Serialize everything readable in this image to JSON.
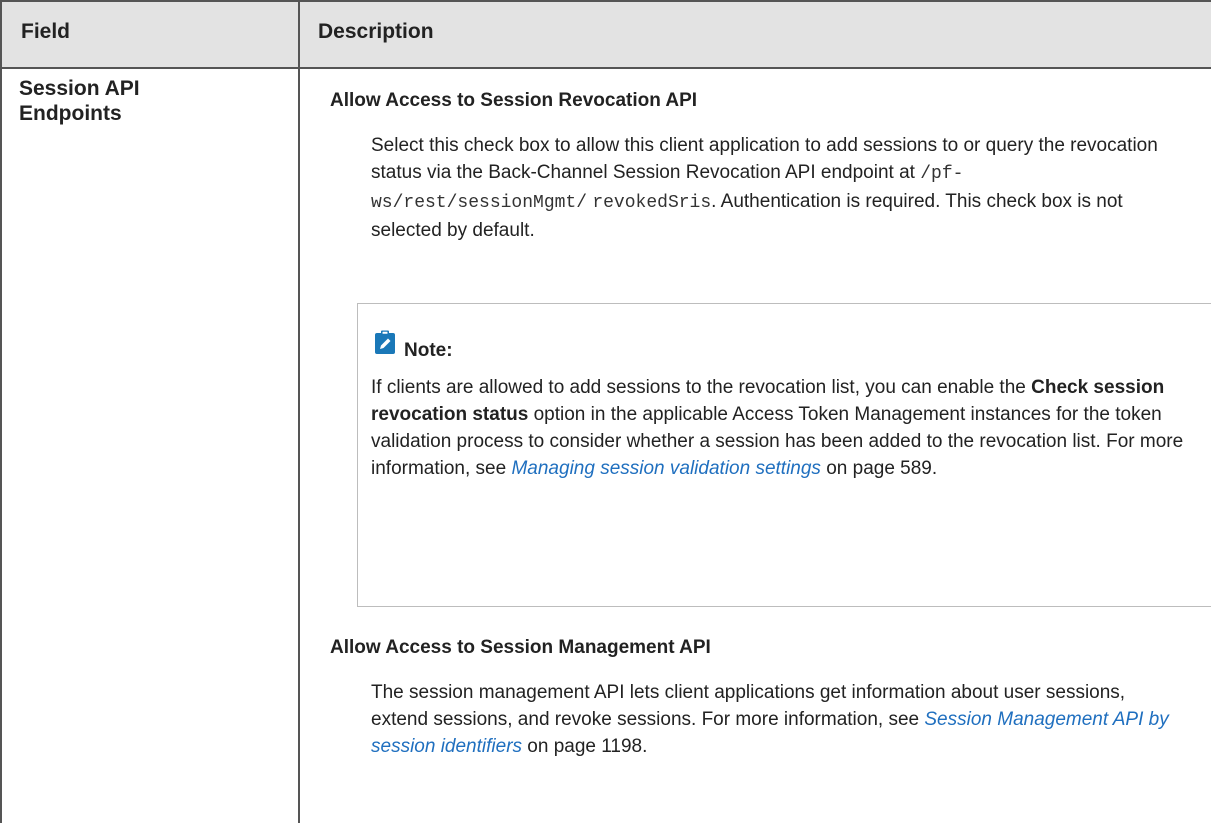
{
  "table": {
    "header_field": "Field",
    "header_description": "Description"
  },
  "row": {
    "field_line1": "Session API",
    "field_line2": "Endpoints"
  },
  "section1": {
    "heading": "Allow Access to Session Revocation API",
    "p_part1": "Select this check box to allow this client application to add sessions to or query the revocation status via the Back-Channel Session Revocation API endpoint at ",
    "p_code1": "/pf-ws/rest/sessionMgmt/",
    "p_code2": "revokedSris",
    "p_part2": ". Authentication is required. This check box is not selected by default."
  },
  "note": {
    "icon": "note-pencil-icon",
    "title": "Note:",
    "t1": "If clients are allowed to add sessions to the revocation list, you can enable the ",
    "bold": "Check session revocation status",
    "t2": " option in the applicable Access Token Management instances for the token validation process to consider whether a session has been added to the revocation list. For more information, see ",
    "link": "Managing session validation settings",
    "t3": " on page 589."
  },
  "section2": {
    "heading": "Allow Access to Session Management API",
    "t1": "The session management API lets client applications get information about user sessions, extend sessions, and revoke sessions. For more information, see ",
    "link": "Session Management API by session identifiers",
    "t2": " on page 1198."
  },
  "colors": {
    "link": "#1f6fbf",
    "note_icon": "#1a78b8",
    "header_bg": "#e3e3e3"
  }
}
